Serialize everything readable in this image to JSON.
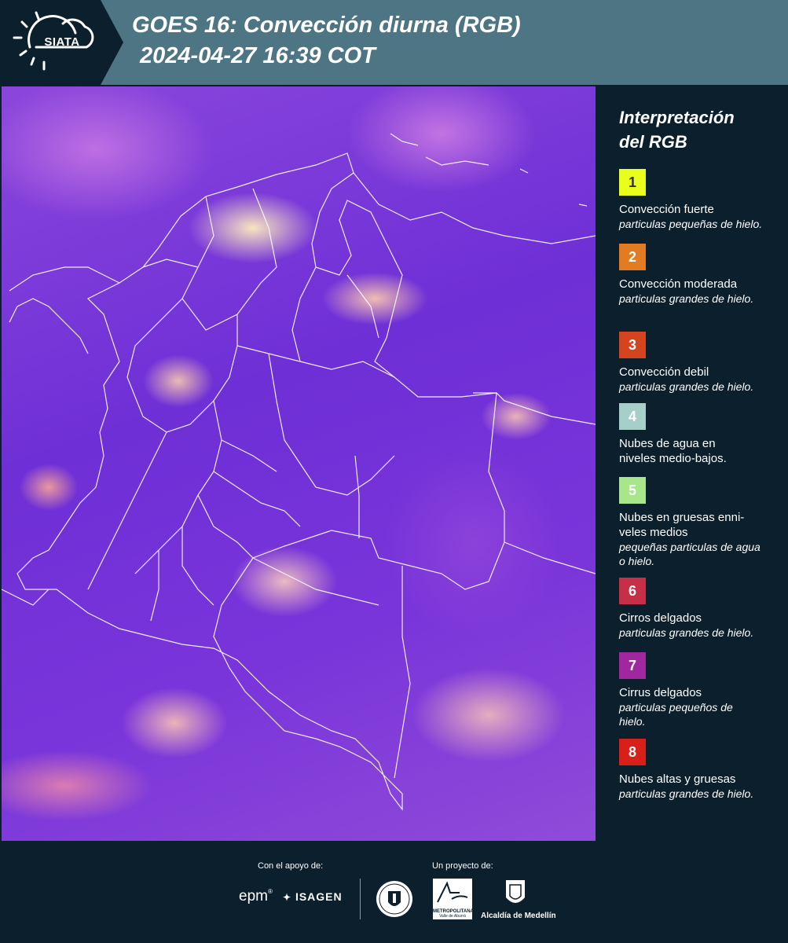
{
  "header": {
    "logo_text": "SIATA",
    "title_line1": "GOES 16: Convección diurna (RGB)",
    "title_line2": "2024-04-27 16:39 COT"
  },
  "map": {
    "content": "GOES-16 day convection RGB satellite image over Colombia with department borders"
  },
  "legend": {
    "title_line1": "Interpretación",
    "title_line2": "del RGB",
    "items": [
      {
        "num": "1",
        "color": "#e8ff1c",
        "num_color": "#333333",
        "title": "Convección fuerte",
        "desc": "particulas pequeñas de hielo."
      },
      {
        "num": "2",
        "color": "#e27b22",
        "num_color": "#ffffff",
        "title": "Convección moderada",
        "desc": "particulas grandes de hielo."
      },
      {
        "num": "3",
        "color": "#d3441f",
        "num_color": "#ffffff",
        "title": "Convección debil",
        "desc": "particulas grandes de hielo."
      },
      {
        "num": "4",
        "color": "#a6cfca",
        "num_color": "#ffffff",
        "title": "Nubes de agua en niveles medio-bajos.",
        "desc": ""
      },
      {
        "num": "5",
        "color": "#a8e68c",
        "num_color": "#ffffff",
        "title": "Nubes en gruesas enni-veles medios",
        "desc": "pequeñas particulas de agua o hielo."
      },
      {
        "num": "6",
        "color": "#c62f45",
        "num_color": "#ffffff",
        "title": "Cirros delgados",
        "desc": "particulas grandes de hielo."
      },
      {
        "num": "7",
        "color": "#a0279e",
        "num_color": "#ffffff",
        "title": "Cirrus delgados",
        "desc": "particulas pequeños de hielo."
      },
      {
        "num": "8",
        "color": "#d81f1a",
        "num_color": "#ffffff",
        "title": "Nubes altas y gruesas",
        "desc": "particulas grandes de hielo."
      }
    ]
  },
  "footer": {
    "support_label": "Con el apoyo de:",
    "project_label": "Un proyecto de:",
    "epm": "epm",
    "isagen": "ISAGEN",
    "metro_name": "METROPOLITANA",
    "metro_sub": "Valle de Aburrá",
    "alcaldia": "Alcaldía de Medellín"
  }
}
